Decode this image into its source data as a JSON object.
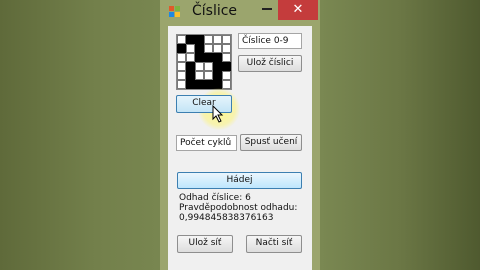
{
  "window": {
    "title": "Číslice",
    "close_glyph": "✕"
  },
  "grid": {
    "rows": 6,
    "cols": 6,
    "cells": [
      [
        0,
        1,
        1,
        0,
        0,
        0
      ],
      [
        1,
        0,
        1,
        0,
        0,
        0
      ],
      [
        0,
        0,
        1,
        1,
        1,
        0
      ],
      [
        0,
        1,
        0,
        0,
        1,
        1
      ],
      [
        0,
        1,
        0,
        0,
        1,
        0
      ],
      [
        0,
        1,
        1,
        1,
        1,
        0
      ]
    ]
  },
  "digit_field": {
    "value": "Číslice 0-9"
  },
  "save_digit_button": {
    "label": "Ulož číslici"
  },
  "clear_button": {
    "label": "Clear"
  },
  "cycles_field": {
    "value": "Počet cyklů"
  },
  "start_learning_button": {
    "label": "Spusť učení"
  },
  "guess_button": {
    "label": "Hádej"
  },
  "result": {
    "estimate": "Odhad číslice: 6",
    "probability_label": "Pravděpodobnost odhadu:",
    "probability_value": "0,994845838376163"
  },
  "save_net_button": {
    "label": "Ulož síť"
  },
  "load_net_button": {
    "label": "Načti síť"
  },
  "colors": {
    "close": "#c43c3c",
    "focus_border": "#3c7fb1",
    "cursor_highlight": "#fff878"
  }
}
